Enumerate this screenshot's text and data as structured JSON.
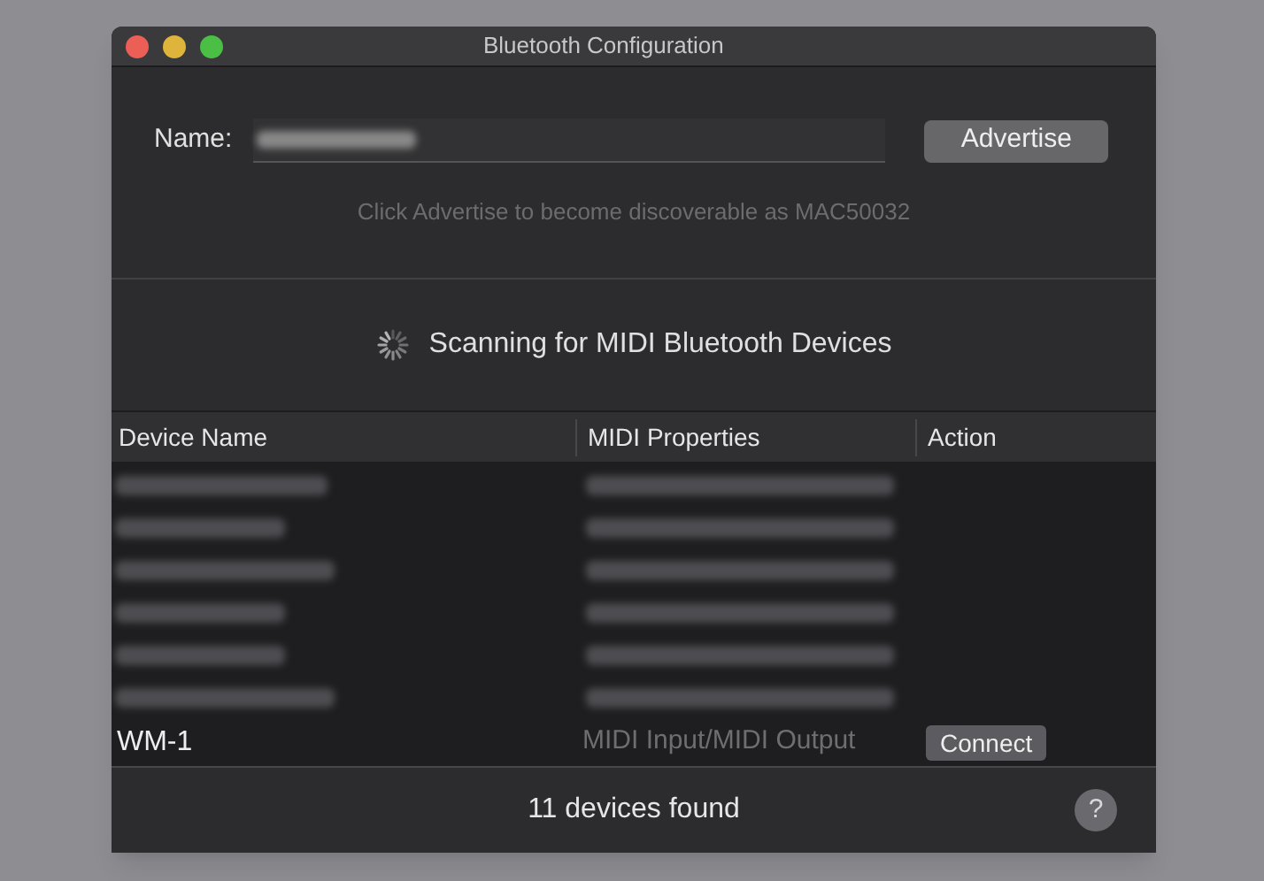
{
  "window": {
    "title": "Bluetooth Configuration"
  },
  "name_field": {
    "label": "Name:"
  },
  "advertise_button": "Advertise",
  "hint": "Click Advertise to become discoverable as MAC50032",
  "scanning": "Scanning for MIDI Bluetooth Devices",
  "table": {
    "columns": [
      "Device Name",
      "MIDI Properties",
      "Action"
    ],
    "rows": [
      {
        "device": "WM-1",
        "properties": "MIDI Input/MIDI Output",
        "action": "Connect"
      }
    ]
  },
  "status_bar": {
    "text": "11 devices found",
    "help": "?"
  }
}
